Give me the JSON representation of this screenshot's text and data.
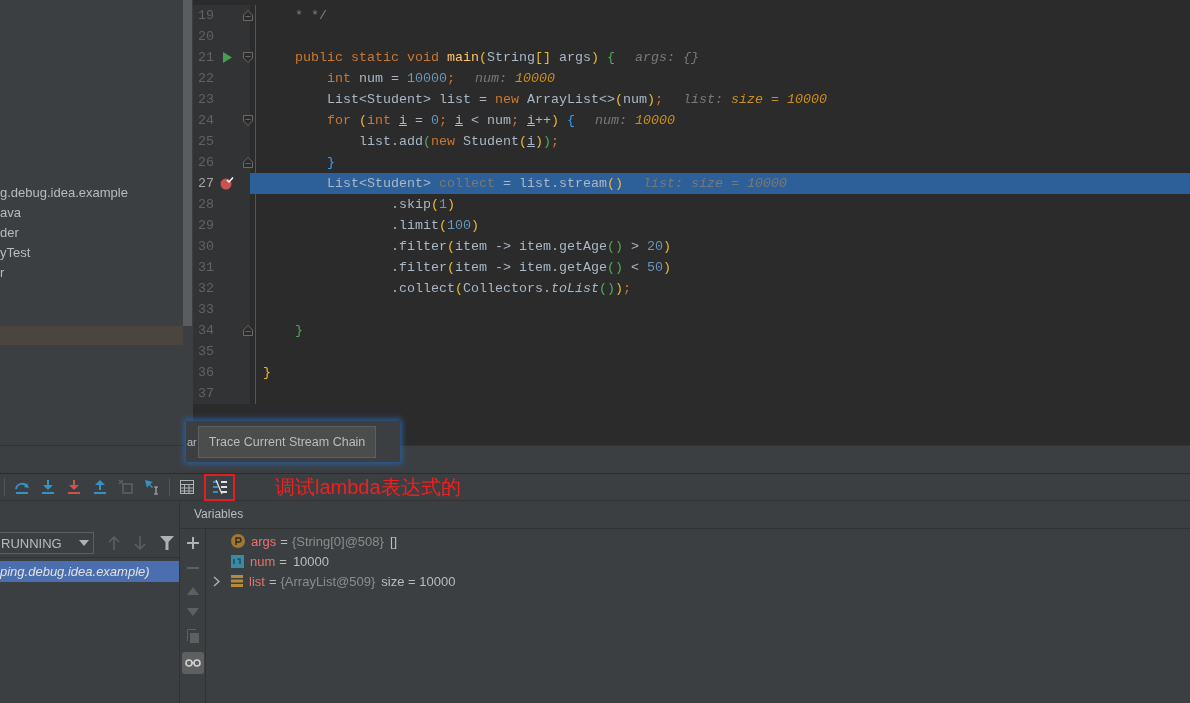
{
  "project_tree": {
    "items": [
      {
        "label": "g.debug.idea.example"
      },
      {
        "label": "ava"
      },
      {
        "label": "der"
      },
      {
        "label": "yTest"
      },
      {
        "label": "r"
      }
    ]
  },
  "editor": {
    "lines": [
      {
        "number": "19",
        "fold_marker": {
          "kind": "end"
        },
        "tokens": [
          {
            "t": "    * */",
            "kind": "comment"
          }
        ]
      },
      {
        "number": "20"
      },
      {
        "number": "21",
        "run_marker": true,
        "fold_marker": {
          "kind": "start"
        },
        "tokens": [
          {
            "t": "    public static void ",
            "kind": "keyword"
          },
          {
            "t": "main",
            "kind": "method"
          },
          {
            "t": "(",
            "kind": "bracket-yellow"
          },
          {
            "t": "String",
            "kind": "plain"
          },
          {
            "t": "[]",
            "kind": "bracket-yellow"
          },
          {
            "t": " args",
            "kind": "plain"
          },
          {
            "t": ")",
            "kind": "bracket-yellow"
          },
          {
            "t": " {",
            "kind": "bracket-green"
          }
        ],
        "hint": {
          "label": "args:",
          "value": "{}",
          "kind": "plain"
        }
      },
      {
        "number": "22",
        "tokens": [
          {
            "t": "        int",
            "kind": "keyword"
          },
          {
            "t": " num = ",
            "kind": "plain"
          },
          {
            "t": "10000",
            "kind": "number"
          },
          {
            "t": ";",
            "kind": "keyword"
          }
        ],
        "hint": {
          "label": "num:",
          "value": "10000",
          "kind": "value"
        }
      },
      {
        "number": "23",
        "tokens": [
          {
            "t": "        List<Student> list = ",
            "kind": "plain"
          },
          {
            "t": "new",
            "kind": "keyword"
          },
          {
            "t": " ArrayList<>",
            "kind": "plain"
          },
          {
            "t": "(",
            "kind": "bracket-yellow"
          },
          {
            "t": "num",
            "kind": "plain"
          },
          {
            "t": ")",
            "kind": "bracket-yellow"
          },
          {
            "t": ";",
            "kind": "keyword"
          }
        ],
        "hint": {
          "label": "list:",
          "value": "size = 10000",
          "kind": "value"
        }
      },
      {
        "number": "24",
        "fold_marker": {
          "kind": "start"
        },
        "tokens": [
          {
            "t": "        for",
            "kind": "keyword"
          },
          {
            "t": " (",
            "kind": "bracket-yellow"
          },
          {
            "t": "int ",
            "kind": "keyword"
          },
          {
            "t": "i",
            "kind": "reassigned"
          },
          {
            "t": " = ",
            "kind": "plain"
          },
          {
            "t": "0",
            "kind": "number"
          },
          {
            "t": "; ",
            "kind": "keyword"
          },
          {
            "t": "i",
            "kind": "reassigned"
          },
          {
            "t": " < num",
            "kind": "plain"
          },
          {
            "t": "; ",
            "kind": "keyword"
          },
          {
            "t": "i",
            "kind": "reassigned"
          },
          {
            "t": "++",
            "kind": "plain"
          },
          {
            "t": ")",
            "kind": "bracket-yellow"
          },
          {
            "t": " {",
            "kind": "bracket-blue"
          }
        ],
        "hint": {
          "label": "num:",
          "value": "10000",
          "kind": "value"
        }
      },
      {
        "number": "25",
        "tokens": [
          {
            "t": "            list.add",
            "kind": "plain"
          },
          {
            "t": "(",
            "kind": "bracket-green"
          },
          {
            "t": "new",
            "kind": "keyword"
          },
          {
            "t": " Student",
            "kind": "plain"
          },
          {
            "t": "(",
            "kind": "bracket-yellow"
          },
          {
            "t": "i",
            "kind": "reassigned"
          },
          {
            "t": ")",
            "kind": "bracket-yellow"
          },
          {
            "t": ")",
            "kind": "bracket-green"
          },
          {
            "t": ";",
            "kind": "keyword"
          }
        ]
      },
      {
        "number": "26",
        "fold_marker": {
          "kind": "end"
        },
        "tokens": [
          {
            "t": "        }",
            "kind": "bracket-blue"
          }
        ]
      },
      {
        "number": "27",
        "selected": true,
        "breakpoint": true,
        "tokens": [
          {
            "t": "        List<Student> ",
            "kind": "plain"
          },
          {
            "t": "collect",
            "kind": "unused"
          },
          {
            "t": " = list.stream",
            "kind": "plain"
          },
          {
            "t": "()",
            "kind": "bracket-yellow"
          }
        ],
        "hint": {
          "label": "list:",
          "value": "size = 10000",
          "kind": "plain"
        }
      },
      {
        "number": "28",
        "tokens": [
          {
            "t": "                .skip",
            "kind": "plain"
          },
          {
            "t": "(",
            "kind": "bracket-yellow"
          },
          {
            "t": "1",
            "kind": "number"
          },
          {
            "t": ")",
            "kind": "bracket-yellow"
          }
        ]
      },
      {
        "number": "29",
        "tokens": [
          {
            "t": "                .limit",
            "kind": "plain"
          },
          {
            "t": "(",
            "kind": "bracket-yellow"
          },
          {
            "t": "100",
            "kind": "number"
          },
          {
            "t": ")",
            "kind": "bracket-yellow"
          }
        ]
      },
      {
        "number": "30",
        "tokens": [
          {
            "t": "                .filter",
            "kind": "plain"
          },
          {
            "t": "(",
            "kind": "bracket-yellow"
          },
          {
            "t": "item -> item.getAge",
            "kind": "plain"
          },
          {
            "t": "()",
            "kind": "bracket-green"
          },
          {
            "t": " > ",
            "kind": "plain"
          },
          {
            "t": "20",
            "kind": "number"
          },
          {
            "t": ")",
            "kind": "bracket-yellow"
          }
        ]
      },
      {
        "number": "31",
        "tokens": [
          {
            "t": "                .filter",
            "kind": "plain"
          },
          {
            "t": "(",
            "kind": "bracket-yellow"
          },
          {
            "t": "item -> item.getAge",
            "kind": "plain"
          },
          {
            "t": "()",
            "kind": "bracket-green"
          },
          {
            "t": " < ",
            "kind": "plain"
          },
          {
            "t": "50",
            "kind": "number"
          },
          {
            "t": ")",
            "kind": "bracket-yellow"
          }
        ]
      },
      {
        "number": "32",
        "tokens": [
          {
            "t": "                .collect",
            "kind": "plain"
          },
          {
            "t": "(",
            "kind": "bracket-yellow"
          },
          {
            "t": "Collectors.",
            "kind": "plain"
          },
          {
            "t": "toList",
            "kind": "static-call"
          },
          {
            "t": "()",
            "kind": "bracket-green"
          },
          {
            "t": ")",
            "kind": "bracket-yellow"
          },
          {
            "t": ";",
            "kind": "keyword"
          }
        ]
      },
      {
        "number": "33"
      },
      {
        "number": "34",
        "fold_marker": {
          "kind": "end"
        },
        "tokens": [
          {
            "t": "    }",
            "kind": "bracket-green"
          }
        ]
      },
      {
        "number": "35"
      },
      {
        "number": "36",
        "tokens": [
          {
            "t": "}",
            "kind": "bracket-yellow"
          }
        ]
      },
      {
        "number": "37"
      }
    ]
  },
  "popup": {
    "partial_label": "ar",
    "tooltip": "Trace Current Stream Chain"
  },
  "annotation": {
    "text": "调试lambda表达式的"
  },
  "frames": {
    "thread_dropdown": "RUNNING",
    "items": [
      {
        "label": "ping.debug.idea.example)",
        "selected": true
      }
    ]
  },
  "variables": {
    "title": "Variables",
    "rows": [
      {
        "kind": "parameter",
        "expandable": false,
        "name": "args",
        "operator": "=",
        "ref": "{String[0]@508}",
        "value": "[]"
      },
      {
        "kind": "primitive",
        "expandable": false,
        "name": "num",
        "operator": "=",
        "value": "10000"
      },
      {
        "kind": "object",
        "expandable": true,
        "name": "list",
        "operator": "=",
        "ref": "{ArrayList@509}",
        "value": "size = 10000"
      }
    ]
  }
}
